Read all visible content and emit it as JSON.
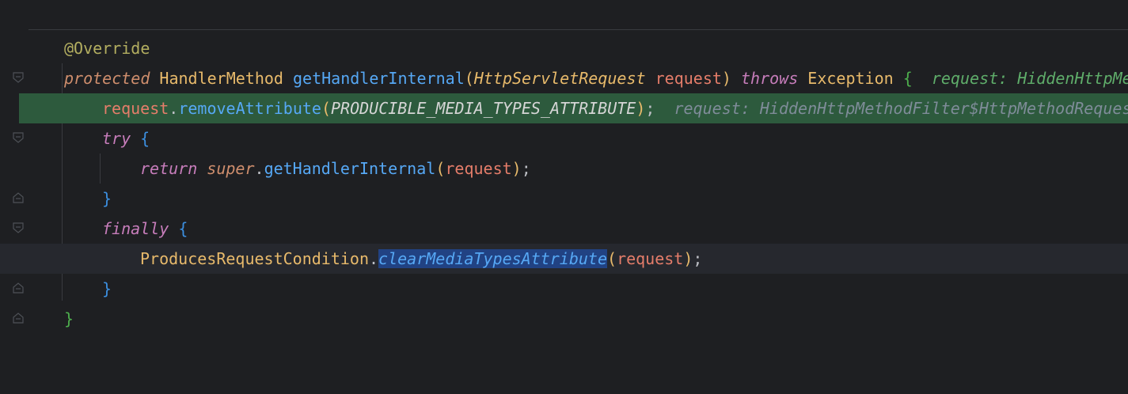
{
  "code": {
    "l1": {
      "annotation": "@Override"
    },
    "l2": {
      "modifier": "protected",
      "return_type": "HandlerMethod",
      "method": "getHandlerInternal",
      "lparen": "(",
      "param_type": "HttpServletRequest",
      "param_name": "request",
      "rparen": ")",
      "throws": "throws",
      "exception": "Exception",
      "brace": "{",
      "hint": "request: HiddenHttpMe"
    },
    "l3": {
      "receiver": "request",
      "dot": ".",
      "method": "removeAttribute",
      "lparen": "(",
      "constant": "PRODUCIBLE_MEDIA_TYPES_ATTRIBUTE",
      "rparen": ")",
      "semi": ";",
      "hint": "request: HiddenHttpMethodFilter$HttpMethodReques"
    },
    "l4": {
      "keyword": "try",
      "brace": "{"
    },
    "l5": {
      "keyword": "return",
      "super_kw": "super",
      "dot": ".",
      "method": "getHandlerInternal",
      "lparen": "(",
      "arg": "request",
      "rparen": ")",
      "semi": ";"
    },
    "l6": {
      "brace": "}"
    },
    "l7": {
      "keyword": "finally",
      "brace": "{"
    },
    "l8": {
      "class_name": "ProducesRequestCondition",
      "dot": ".",
      "method": "clearMediaTypesAttribute",
      "lparen": "(",
      "arg": "request",
      "rparen": ")",
      "semi": ";"
    },
    "l9": {
      "brace": "}"
    },
    "l10": {
      "brace": "}"
    }
  },
  "colors": {
    "background": "#1e1f22",
    "execution_line": "#2d5a3d",
    "selection": "#214283"
  }
}
